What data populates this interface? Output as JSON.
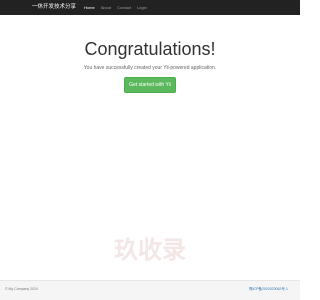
{
  "navbar": {
    "brand": "一休开发技术分享",
    "links": [
      {
        "label": "Home",
        "active": true
      },
      {
        "label": "About",
        "active": false
      },
      {
        "label": "Contact",
        "active": false
      },
      {
        "label": "Login",
        "active": false
      }
    ]
  },
  "jumbotron": {
    "headline": "Congratulations!",
    "lead": "You have successfully created your Yii-powered application.",
    "cta_label": "Get started with Yii"
  },
  "footer": {
    "copyright": "© My Company 2024",
    "icp": "豫ICP备2020023062号-1"
  },
  "watermark": {
    "text": "玖收录",
    "color": "#f5e9e9"
  },
  "colors": {
    "navbar_bg": "#222222",
    "cta_bg": "#5cb85c",
    "link": "#337ab7"
  }
}
